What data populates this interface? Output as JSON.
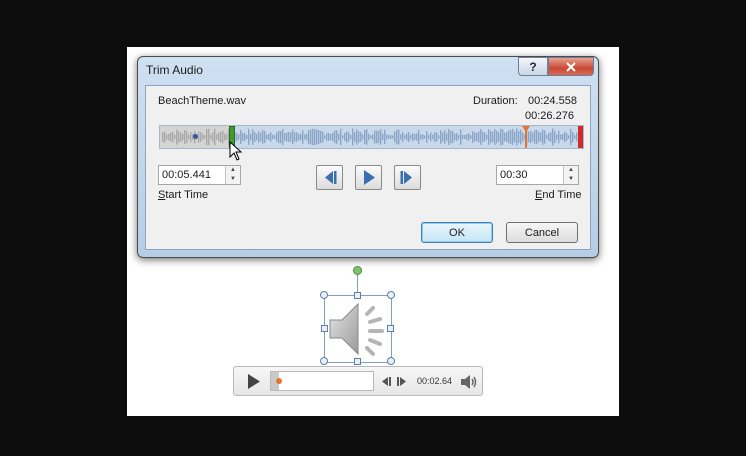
{
  "dialog": {
    "title": "Trim Audio",
    "help_label": "?",
    "file_name": "BeachTheme.wav",
    "duration_label": "Duration:",
    "duration_value": "00:24.558",
    "end_marker_time": "00:26.276",
    "start_time_value": "00:05.441",
    "start_time_label": "Start Time",
    "end_time_value": "00:30",
    "end_time_label": "End Time",
    "ok_label": "OK",
    "cancel_label": "Cancel"
  },
  "player": {
    "time": "00:02.64"
  },
  "colors": {
    "start_marker": "#3f9a2b",
    "end_marker": "#d12a2a",
    "playhead": "#e5742d",
    "selected_wave": "#c9d8ea",
    "trimmed_wave": "#d4d4d4"
  },
  "icons": [
    "help-icon",
    "close-icon",
    "previous-frame-icon",
    "play-icon",
    "next-frame-icon",
    "speaker-icon",
    "volume-icon",
    "cursor-icon"
  ]
}
